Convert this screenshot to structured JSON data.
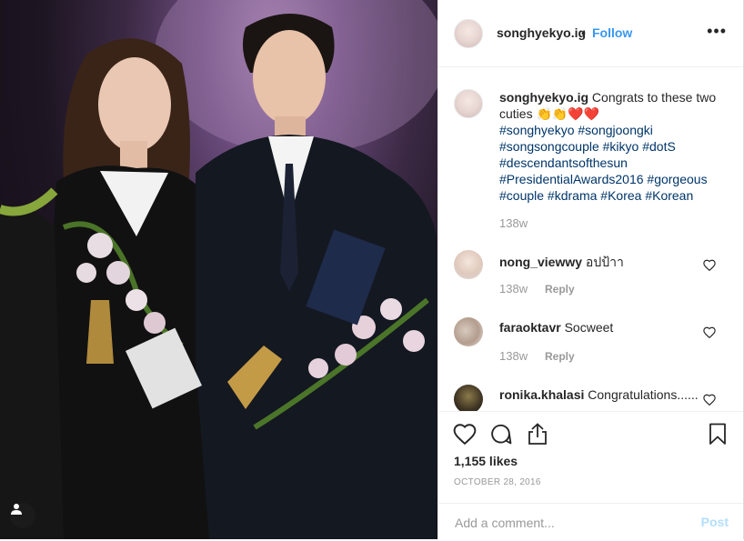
{
  "post": {
    "username": "songhyekyo.ig",
    "separator": "•",
    "follow_label": "Follow",
    "more_label": "•••"
  },
  "caption": {
    "username": "songhyekyo.ig",
    "text": "Congrats to these two cuties 👏👏❤️❤️",
    "hashtags": "#songhyekyo #songjoongki #songsongcouple #kikyo #dotS #descendantsofthesun #PresidentialAwards2016 #gorgeous #couple #kdrama #Korea #Korean",
    "time": "138w"
  },
  "comments": [
    {
      "username": "nong_viewwy",
      "text": "อปป้าา",
      "time": "138w",
      "reply_label": "Reply"
    },
    {
      "username": "faraoktavr",
      "text": "Socweet",
      "time": "138w",
      "reply_label": "Reply"
    },
    {
      "username": "ronika.khalasi",
      "text": "Congratulations......",
      "time": "",
      "reply_label": ""
    }
  ],
  "actions": {
    "likes": "1,155 likes",
    "date": "OCTOBER 28, 2016"
  },
  "composer": {
    "placeholder": "Add a comment...",
    "post_label": "Post"
  },
  "icons": [
    "heart-icon",
    "comment-icon",
    "share-icon",
    "bookmark-icon",
    "user-tag-icon",
    "more-icon"
  ],
  "colors": {
    "link": "#3897f0",
    "hashtag": "#003569",
    "muted": "#999999",
    "post_disabled": "#b2dffc"
  }
}
